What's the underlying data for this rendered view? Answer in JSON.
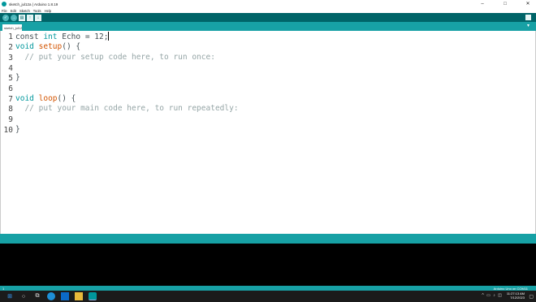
{
  "window": {
    "title": "sketch_jul12a | Arduino 1.8.19",
    "minimize": "–",
    "maximize": "□",
    "close": "✕"
  },
  "menu": [
    "File",
    "Edit",
    "Sketch",
    "Tools",
    "Help"
  ],
  "toolbar": {
    "verify_icon": "✓",
    "upload_icon": "→",
    "new_icon": "▤",
    "open_icon": "↑",
    "save_icon": "↓"
  },
  "tab": {
    "name": "sketch_jul12a",
    "menu_icon": "▾"
  },
  "code": {
    "line_numbers": [
      "1",
      "2",
      "3",
      "4",
      "5",
      "6",
      "7",
      "8",
      "9",
      "10"
    ],
    "l1_a": "const ",
    "l1_b": "int",
    "l1_c": " Echo = 12;",
    "l2_a": "void",
    "l2_b": " ",
    "l2_c": "setup",
    "l2_d": "() {",
    "l3": "  // put your setup code here, to run once:",
    "l4": "",
    "l5": "}",
    "l6": "",
    "l7_a": "void",
    "l7_b": " ",
    "l7_c": "loop",
    "l7_d": "() {",
    "l8": "  // put your main code here, to run repeatedly:",
    "l9": "",
    "l10": "}"
  },
  "footer": {
    "line_number": "1",
    "board": "Arduino Uno on COM11"
  },
  "taskbar": {
    "start_icon": "⊞",
    "search_icon": "○",
    "task_view_icon": "⧉",
    "tray_icons": "^ ▭ ♪ ◫",
    "time": "11:27:13 AM",
    "date": "7/12/2023",
    "notification_icon": "▢"
  },
  "colors": {
    "toolbar": "#006468",
    "tabbar": "#17a1a5",
    "keyword": "#00979c",
    "function": "#d35400",
    "comment": "#95a5a6"
  }
}
